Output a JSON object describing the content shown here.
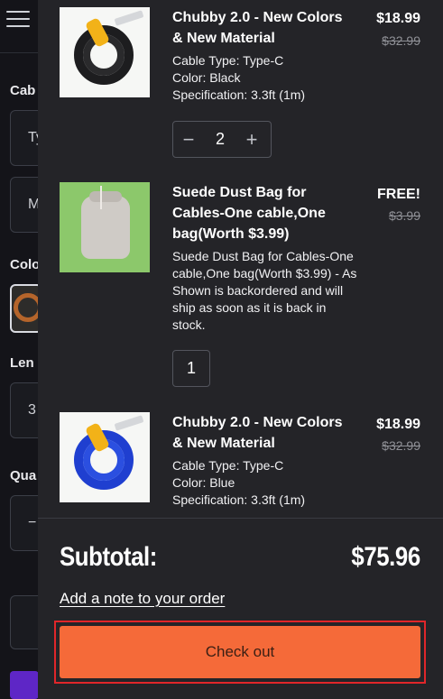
{
  "background": {
    "labels": {
      "cable": "Cab",
      "color": "Colo",
      "length": "Len",
      "quantity": "Qua"
    },
    "boxes": {
      "type_value": "Ty",
      "material_value": "M",
      "length_value": "3",
      "qty_minus": "−"
    }
  },
  "cart": {
    "items": [
      {
        "title": "Chubby 2.0 - New Colors & New Material",
        "options": [
          "Cable Type: Type-C",
          "Color: Black",
          "Specification: 3.3ft (1m)"
        ],
        "price": "$18.99",
        "compare_price": "$32.99",
        "quantity": "2",
        "coil_color": "#1d1d1f"
      },
      {
        "title": "Suede Dust Bag for Cables-One cable,One bag(Worth $3.99)",
        "description": "Suede Dust Bag for Cables-One cable,One bag(Worth $3.99) - As Shown is backordered and will ship as soon as it is back in stock.",
        "price": "FREE!",
        "compare_price": "$3.99",
        "quantity": "1"
      },
      {
        "title": "Chubby 2.0 - New Colors & New Material",
        "options": [
          "Cable Type: Type-C",
          "Color: Blue",
          "Specification: 3.3ft (1m)"
        ],
        "price": "$18.99",
        "compare_price": "$32.99",
        "coil_color": "#1f3fd0"
      }
    ],
    "subtotal_label": "Subtotal:",
    "subtotal_value": "$75.96",
    "note_link": "Add a note to your order",
    "checkout_label": "Check out"
  },
  "colors": {
    "accent": "#f56a39",
    "drawer_bg": "#242428",
    "focus_outline": "#e0262a"
  },
  "icons": {
    "menu": "hamburger-icon",
    "minus": "minus-icon",
    "plus": "plus-icon"
  }
}
